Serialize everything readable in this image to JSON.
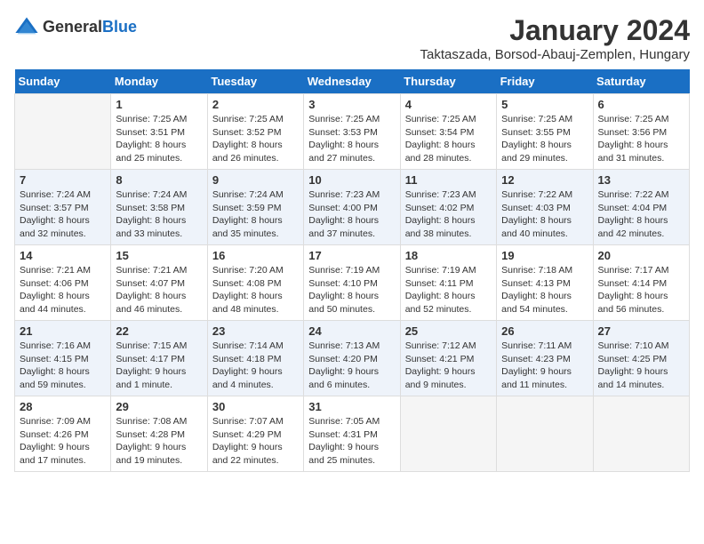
{
  "logo": {
    "text_general": "General",
    "text_blue": "Blue"
  },
  "title": {
    "month": "January 2024",
    "location": "Taktaszada, Borsod-Abauj-Zemplen, Hungary"
  },
  "weekdays": [
    "Sunday",
    "Monday",
    "Tuesday",
    "Wednesday",
    "Thursday",
    "Friday",
    "Saturday"
  ],
  "weeks": [
    [
      {
        "day": "",
        "sunrise": "",
        "sunset": "",
        "daylight": ""
      },
      {
        "day": "1",
        "sunrise": "Sunrise: 7:25 AM",
        "sunset": "Sunset: 3:51 PM",
        "daylight": "Daylight: 8 hours and 25 minutes."
      },
      {
        "day": "2",
        "sunrise": "Sunrise: 7:25 AM",
        "sunset": "Sunset: 3:52 PM",
        "daylight": "Daylight: 8 hours and 26 minutes."
      },
      {
        "day": "3",
        "sunrise": "Sunrise: 7:25 AM",
        "sunset": "Sunset: 3:53 PM",
        "daylight": "Daylight: 8 hours and 27 minutes."
      },
      {
        "day": "4",
        "sunrise": "Sunrise: 7:25 AM",
        "sunset": "Sunset: 3:54 PM",
        "daylight": "Daylight: 8 hours and 28 minutes."
      },
      {
        "day": "5",
        "sunrise": "Sunrise: 7:25 AM",
        "sunset": "Sunset: 3:55 PM",
        "daylight": "Daylight: 8 hours and 29 minutes."
      },
      {
        "day": "6",
        "sunrise": "Sunrise: 7:25 AM",
        "sunset": "Sunset: 3:56 PM",
        "daylight": "Daylight: 8 hours and 31 minutes."
      }
    ],
    [
      {
        "day": "7",
        "sunrise": "Sunrise: 7:24 AM",
        "sunset": "Sunset: 3:57 PM",
        "daylight": "Daylight: 8 hours and 32 minutes."
      },
      {
        "day": "8",
        "sunrise": "Sunrise: 7:24 AM",
        "sunset": "Sunset: 3:58 PM",
        "daylight": "Daylight: 8 hours and 33 minutes."
      },
      {
        "day": "9",
        "sunrise": "Sunrise: 7:24 AM",
        "sunset": "Sunset: 3:59 PM",
        "daylight": "Daylight: 8 hours and 35 minutes."
      },
      {
        "day": "10",
        "sunrise": "Sunrise: 7:23 AM",
        "sunset": "Sunset: 4:00 PM",
        "daylight": "Daylight: 8 hours and 37 minutes."
      },
      {
        "day": "11",
        "sunrise": "Sunrise: 7:23 AM",
        "sunset": "Sunset: 4:02 PM",
        "daylight": "Daylight: 8 hours and 38 minutes."
      },
      {
        "day": "12",
        "sunrise": "Sunrise: 7:22 AM",
        "sunset": "Sunset: 4:03 PM",
        "daylight": "Daylight: 8 hours and 40 minutes."
      },
      {
        "day": "13",
        "sunrise": "Sunrise: 7:22 AM",
        "sunset": "Sunset: 4:04 PM",
        "daylight": "Daylight: 8 hours and 42 minutes."
      }
    ],
    [
      {
        "day": "14",
        "sunrise": "Sunrise: 7:21 AM",
        "sunset": "Sunset: 4:06 PM",
        "daylight": "Daylight: 8 hours and 44 minutes."
      },
      {
        "day": "15",
        "sunrise": "Sunrise: 7:21 AM",
        "sunset": "Sunset: 4:07 PM",
        "daylight": "Daylight: 8 hours and 46 minutes."
      },
      {
        "day": "16",
        "sunrise": "Sunrise: 7:20 AM",
        "sunset": "Sunset: 4:08 PM",
        "daylight": "Daylight: 8 hours and 48 minutes."
      },
      {
        "day": "17",
        "sunrise": "Sunrise: 7:19 AM",
        "sunset": "Sunset: 4:10 PM",
        "daylight": "Daylight: 8 hours and 50 minutes."
      },
      {
        "day": "18",
        "sunrise": "Sunrise: 7:19 AM",
        "sunset": "Sunset: 4:11 PM",
        "daylight": "Daylight: 8 hours and 52 minutes."
      },
      {
        "day": "19",
        "sunrise": "Sunrise: 7:18 AM",
        "sunset": "Sunset: 4:13 PM",
        "daylight": "Daylight: 8 hours and 54 minutes."
      },
      {
        "day": "20",
        "sunrise": "Sunrise: 7:17 AM",
        "sunset": "Sunset: 4:14 PM",
        "daylight": "Daylight: 8 hours and 56 minutes."
      }
    ],
    [
      {
        "day": "21",
        "sunrise": "Sunrise: 7:16 AM",
        "sunset": "Sunset: 4:15 PM",
        "daylight": "Daylight: 8 hours and 59 minutes."
      },
      {
        "day": "22",
        "sunrise": "Sunrise: 7:15 AM",
        "sunset": "Sunset: 4:17 PM",
        "daylight": "Daylight: 9 hours and 1 minute."
      },
      {
        "day": "23",
        "sunrise": "Sunrise: 7:14 AM",
        "sunset": "Sunset: 4:18 PM",
        "daylight": "Daylight: 9 hours and 4 minutes."
      },
      {
        "day": "24",
        "sunrise": "Sunrise: 7:13 AM",
        "sunset": "Sunset: 4:20 PM",
        "daylight": "Daylight: 9 hours and 6 minutes."
      },
      {
        "day": "25",
        "sunrise": "Sunrise: 7:12 AM",
        "sunset": "Sunset: 4:21 PM",
        "daylight": "Daylight: 9 hours and 9 minutes."
      },
      {
        "day": "26",
        "sunrise": "Sunrise: 7:11 AM",
        "sunset": "Sunset: 4:23 PM",
        "daylight": "Daylight: 9 hours and 11 minutes."
      },
      {
        "day": "27",
        "sunrise": "Sunrise: 7:10 AM",
        "sunset": "Sunset: 4:25 PM",
        "daylight": "Daylight: 9 hours and 14 minutes."
      }
    ],
    [
      {
        "day": "28",
        "sunrise": "Sunrise: 7:09 AM",
        "sunset": "Sunset: 4:26 PM",
        "daylight": "Daylight: 9 hours and 17 minutes."
      },
      {
        "day": "29",
        "sunrise": "Sunrise: 7:08 AM",
        "sunset": "Sunset: 4:28 PM",
        "daylight": "Daylight: 9 hours and 19 minutes."
      },
      {
        "day": "30",
        "sunrise": "Sunrise: 7:07 AM",
        "sunset": "Sunset: 4:29 PM",
        "daylight": "Daylight: 9 hours and 22 minutes."
      },
      {
        "day": "31",
        "sunrise": "Sunrise: 7:05 AM",
        "sunset": "Sunset: 4:31 PM",
        "daylight": "Daylight: 9 hours and 25 minutes."
      },
      {
        "day": "",
        "sunrise": "",
        "sunset": "",
        "daylight": ""
      },
      {
        "day": "",
        "sunrise": "",
        "sunset": "",
        "daylight": ""
      },
      {
        "day": "",
        "sunrise": "",
        "sunset": "",
        "daylight": ""
      }
    ]
  ]
}
